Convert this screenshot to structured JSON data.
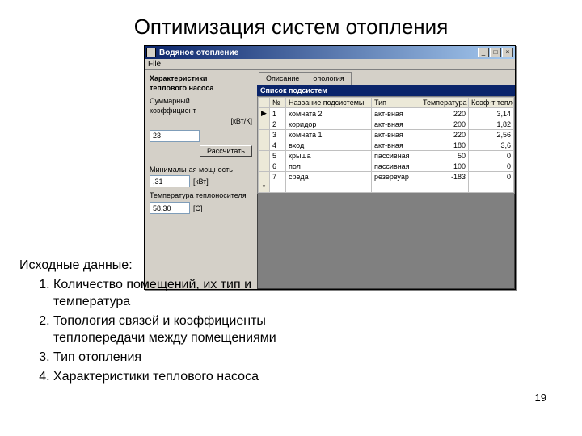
{
  "slide": {
    "title": "Оптимизация систем отопления",
    "page_number": "19",
    "text_heading": "Исходные данные:",
    "items": [
      "Количество помещений, их тип и температура",
      "Топология связей и коэффициенты теплопередачи между помещениями",
      "Тип отопления",
      "Характеристики теплового насоса"
    ]
  },
  "window": {
    "title": "Водяное отопление",
    "menu": {
      "file": "File"
    },
    "left": {
      "heading1": "Характеристики",
      "heading2": "теплового насоса",
      "sum_label1": "Суммарный",
      "sum_label2": "коэффициент",
      "coef_unit": "[кВт/К]",
      "coef_value": "23",
      "calc_btn": "Рассчитать",
      "min_label": "Минимальная мощность",
      "min_unit": "[кВт]",
      "min_value": ",31",
      "temp_label": "Температура теплоносителя",
      "temp_unit": "[С]",
      "temp_value": "58,30"
    },
    "tabs": {
      "t1": "Описание",
      "t2": "опология"
    },
    "table": {
      "caption": "Список подсистем",
      "headers": {
        "n": "№",
        "name": "Название подсистемы",
        "type": "Тип",
        "temp": "Температура",
        "coef": "Коэф-т теплопер"
      },
      "rows": [
        {
          "marker": "▶",
          "n": "1",
          "name": "комната 2",
          "type": "акт-вная",
          "temp": "220",
          "coef": "3,14"
        },
        {
          "marker": "",
          "n": "2",
          "name": "коридор",
          "type": "акт-вная",
          "temp": "200",
          "coef": "1,82"
        },
        {
          "marker": "",
          "n": "3",
          "name": "комната 1",
          "type": "акт-вная",
          "temp": "220",
          "coef": "2,56"
        },
        {
          "marker": "",
          "n": "4",
          "name": "вход",
          "type": "акт-вная",
          "temp": "180",
          "coef": "3,6"
        },
        {
          "marker": "",
          "n": "5",
          "name": "крыша",
          "type": "пассивная",
          "temp": "50",
          "coef": "0"
        },
        {
          "marker": "",
          "n": "6",
          "name": "пол",
          "type": "пассивная",
          "temp": "100",
          "coef": "0"
        },
        {
          "marker": "",
          "n": "7",
          "name": "среда",
          "type": "резервуар",
          "temp": "-183",
          "coef": "0"
        }
      ],
      "newrow": "*"
    }
  }
}
